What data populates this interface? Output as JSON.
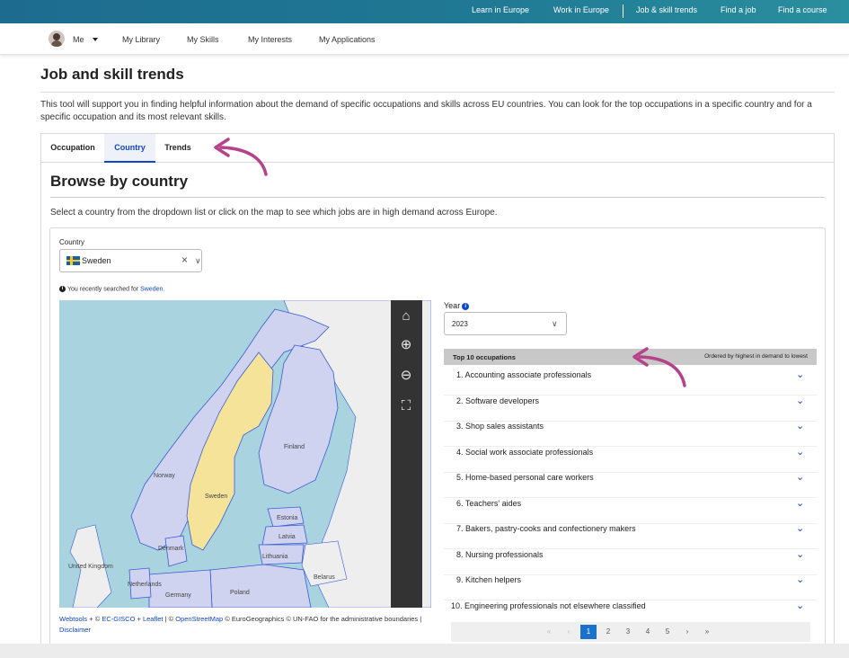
{
  "top_nav": [
    "Learn in Europe",
    "Work in Europe",
    "Job & skill trends",
    "Find a job",
    "Find a course"
  ],
  "user_nav": {
    "me": "Me",
    "items": [
      "My Library",
      "My Skills",
      "My Interests",
      "My Applications"
    ]
  },
  "page": {
    "title": "Job and skill trends",
    "intro": "This tool will support you in finding helpful information about the demand of specific occupations and skills across EU countries. You can look for the top occupations in a specific country and for a specific occupation and its most relevant skills."
  },
  "tabs": [
    "Occupation",
    "Country",
    "Trends"
  ],
  "active_tab": "Country",
  "browse": {
    "title": "Browse by country",
    "description": "Select a country from the dropdown list or click on the map to see which jobs are in high demand across Europe.",
    "country_label": "Country",
    "country_value": "Sweden",
    "recent_prefix": "You recently searched for",
    "recent_link": "Sweden."
  },
  "map": {
    "labels": [
      "Finland",
      "Norway",
      "Sweden",
      "Estonia",
      "Latvia",
      "Lithuania",
      "Belarus",
      "Denmark",
      "United Kingdom",
      "Netherlands",
      "Germany",
      "Poland"
    ],
    "highlighted_country": "Sweden",
    "tool_icons": [
      "home-icon",
      "zoom-in-icon",
      "zoom-out-icon",
      "fullscreen-icon"
    ],
    "attribution": {
      "webtools": "Webtools",
      "plus1": " + © ",
      "ec_gisco": "EC-GISCO",
      "plus2": " + ",
      "leaflet": "Leaflet",
      "sep": " | © ",
      "osm": "OpenStreetMap",
      "rest": " © EuroGeographics © UN-FAO for the administrative boundaries | ",
      "disclaimer": "Disclaimer"
    }
  },
  "year": {
    "label": "Year",
    "value": "2023"
  },
  "occupations": {
    "heading": "Top 10 occupations",
    "ordering": "Ordered by highest in demand to lowest",
    "items": [
      "1.  Accounting associate professionals",
      "2.  Software developers",
      "3.  Shop sales assistants",
      "4.  Social work associate professionals",
      "5.  Home-based personal care workers",
      "6.  Teachers' aides",
      "7.  Bakers, pastry-cooks and confectionery makers",
      "8.  Nursing professionals",
      "9.  Kitchen helpers",
      "10.  Engineering professionals not elsewhere classified"
    ]
  },
  "pagination": {
    "first": "«",
    "prev": "‹",
    "pages": [
      "1",
      "2",
      "3",
      "4",
      "5"
    ],
    "next": "›",
    "last": "»",
    "current": "1"
  },
  "colors": {
    "accent": "#0e47cb",
    "sweden": "#f5e39a",
    "annotation_arrow": "#b5428a"
  }
}
